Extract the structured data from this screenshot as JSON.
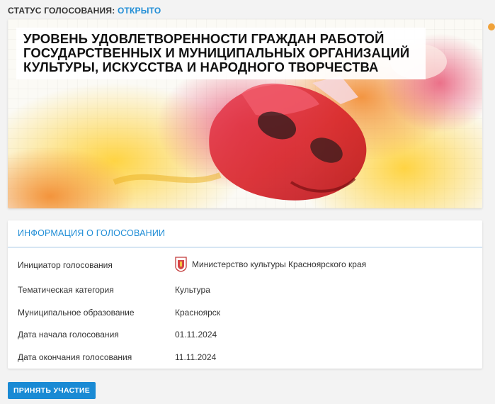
{
  "status": {
    "label": "СТАТУС ГОЛОСОВАНИЯ:",
    "value": "ОТКРЫТО"
  },
  "banner": {
    "title": "УРОВЕНЬ УДОВЛЕТВОРЕННОСТИ ГРАЖДАН РАБОТОЙ ГОСУДАРСТВЕННЫХ И МУНИЦИПАЛЬНЫХ ОРГАНИЗАЦИЙ КУЛЬТУРЫ, ИСКУССТВА И НАРОДНОГО ТВОРЧЕСТВА"
  },
  "info": {
    "header": "ИНФОРМАЦИЯ О ГОЛОСОВАНИИ",
    "rows": [
      {
        "label": "Инициатор голосования",
        "value": "Министерство культуры Красноярского края"
      },
      {
        "label": "Тематическая категория",
        "value": "Культура"
      },
      {
        "label": "Муниципальное образование",
        "value": "Красноярск"
      },
      {
        "label": "Дата начала голосования",
        "value": "01.11.2024"
      },
      {
        "label": "Дата окончания голосования",
        "value": "11.11.2024"
      }
    ]
  },
  "actions": {
    "participate_label": "ПРИНЯТЬ УЧАСТИЕ"
  },
  "colors": {
    "accent": "#1f8dd6",
    "button": "#1a8ad4"
  }
}
